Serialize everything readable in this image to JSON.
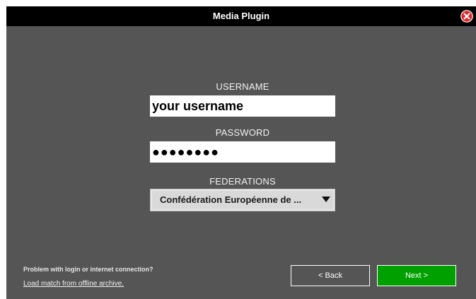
{
  "window": {
    "title": "Media Plugin"
  },
  "login": {
    "username_label": "USERNAME",
    "username_value": "your username",
    "password_label": "PASSWORD",
    "password_value": "●●●●●●●●",
    "federations_label": "FEDERATIONS",
    "federation_selected": "Confédération Européenne de ..."
  },
  "footer": {
    "help_text": "Problem with login or internet connection?",
    "offline_link": "Load match from offline archive.",
    "back_label": "< Back",
    "next_label": "Next >"
  },
  "colors": {
    "titlebar": "#000000",
    "panel": "#555555",
    "close": "#e0262b",
    "next_button": "#00a000"
  },
  "icons": {
    "close": "close-icon",
    "dropdown": "triangle-down-icon"
  }
}
